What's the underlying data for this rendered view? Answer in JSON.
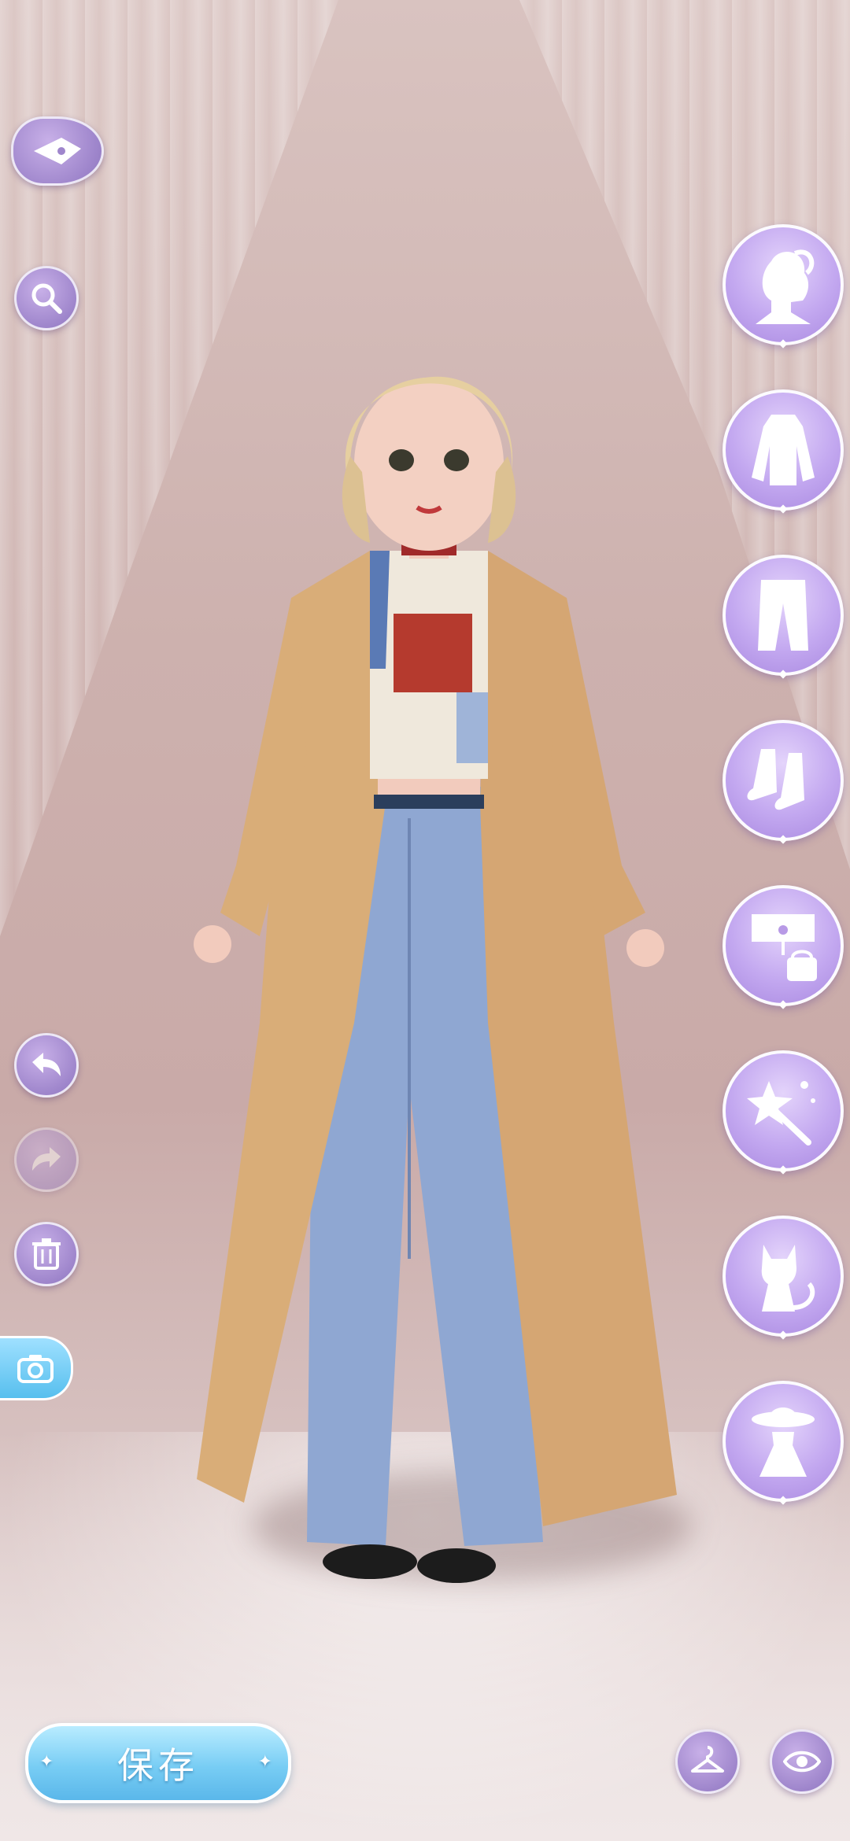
{
  "buttons": {
    "save_label": "保存"
  },
  "icons": {
    "back": "brush-back-icon",
    "search": "search-icon",
    "undo": "undo-icon",
    "redo": "redo-icon",
    "delete": "trash-icon",
    "camera": "camera-icon",
    "wardrobe": "hanger-icon",
    "preview": "eye-icon"
  },
  "categories": [
    {
      "id": "hair",
      "icon": "hair-icon"
    },
    {
      "id": "tops",
      "icon": "top-icon"
    },
    {
      "id": "bottoms",
      "icon": "pants-icon"
    },
    {
      "id": "shoes",
      "icon": "shoes-icon"
    },
    {
      "id": "accessories",
      "icon": "accessories-icon"
    },
    {
      "id": "effects",
      "icon": "magic-wand-icon"
    },
    {
      "id": "pets",
      "icon": "cat-icon"
    },
    {
      "id": "outfits",
      "icon": "outfit-icon"
    }
  ],
  "colors": {
    "accent_purple": "#a989e0",
    "save_blue": "#78cdf4",
    "camera_blue": "#57bfee"
  }
}
